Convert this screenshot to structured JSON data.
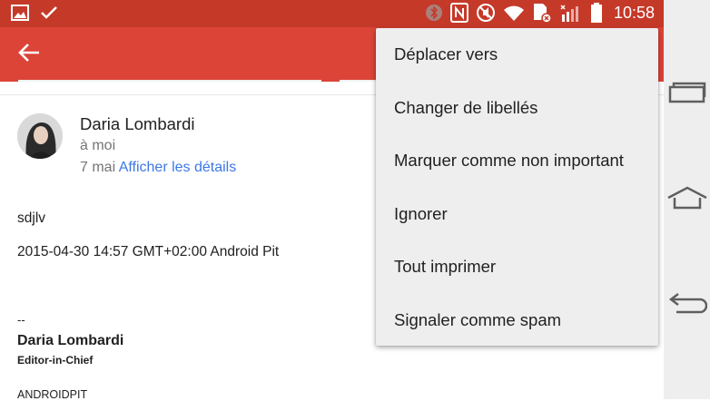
{
  "status_bar": {
    "time": "10:58",
    "left_icons": [
      "image-icon",
      "check-icon"
    ],
    "right_icons": [
      "bluetooth-icon",
      "nfc-icon",
      "mute-icon",
      "wifi-icon",
      "sim-icon",
      "signal-icon",
      "battery-icon"
    ],
    "background_color": "#C53929"
  },
  "app_bar": {
    "back_icon": "arrow-back-icon",
    "background_color": "#DB4437"
  },
  "email": {
    "sender_name": "Daria Lombardi",
    "recipient": "à moi",
    "date": "7 mai",
    "details_link": "Afficher les détails",
    "body_lines": [
      "sdjlv",
      "2015-04-30 14:57 GMT+02:00 Android Pit"
    ],
    "signature": {
      "dash": "--",
      "name": "Daria Lombardi",
      "role": "Editor-in-Chief",
      "company": "ANDROIDPIT"
    }
  },
  "overflow_menu": {
    "items": [
      "Déplacer vers",
      "Changer de libellés",
      "Marquer comme non important",
      "Ignorer",
      "Tout imprimer",
      "Signaler comme spam"
    ]
  },
  "nav_bar": {
    "buttons": [
      "recent-apps-icon",
      "home-icon",
      "back-icon"
    ]
  }
}
